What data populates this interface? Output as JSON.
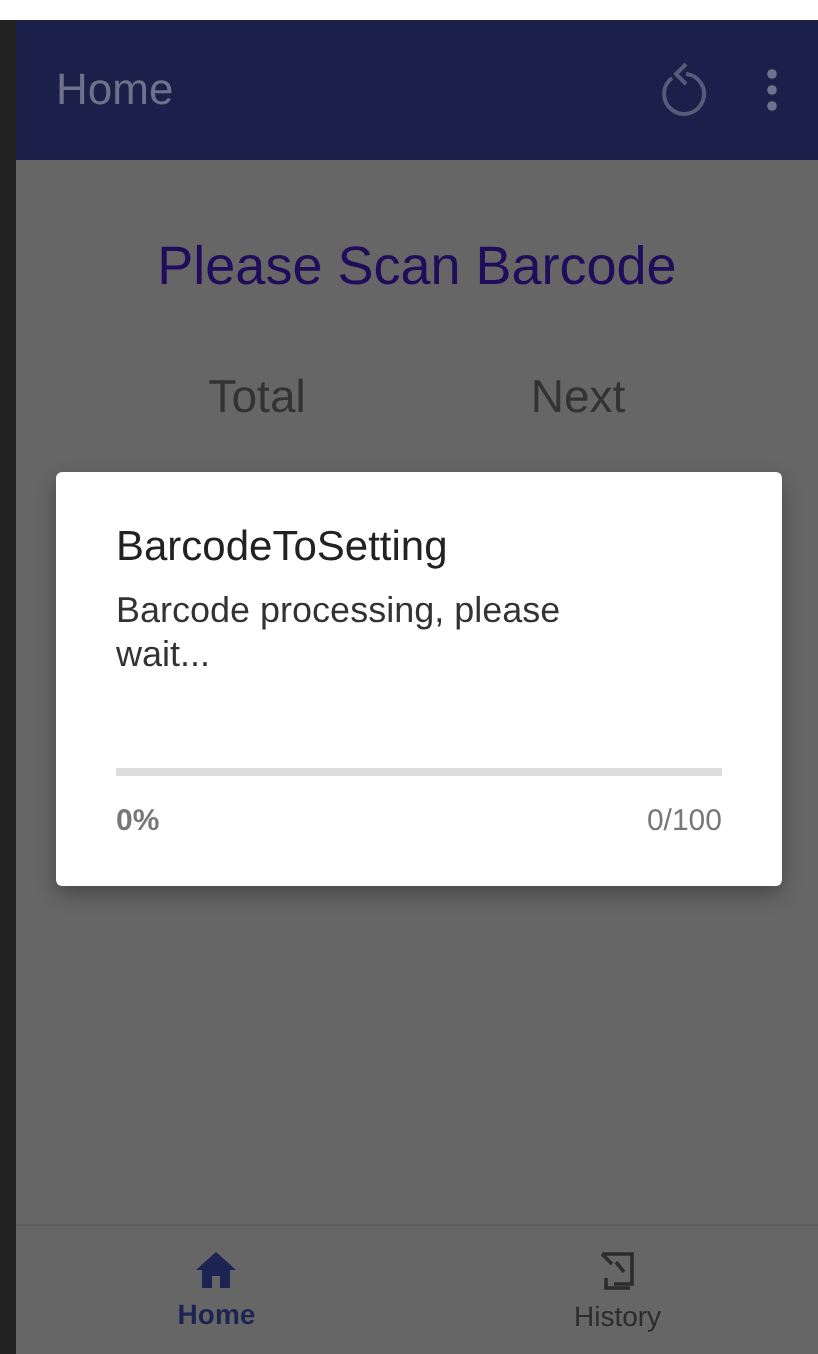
{
  "app_bar": {
    "title": "Home"
  },
  "prompt": "Please Scan Barcode",
  "counters": [
    {
      "label": "Total"
    },
    {
      "label": "Next"
    }
  ],
  "dialog": {
    "title": "BarcodeToSetting",
    "message": "Barcode processing, please wait...",
    "level": 0,
    "percent": "0%",
    "count": "0/100"
  },
  "bottom_nav": [
    {
      "label": "Home",
      "kind": "home",
      "selected": true
    },
    {
      "label": "History",
      "kind": "history",
      "selected": false
    }
  ]
}
